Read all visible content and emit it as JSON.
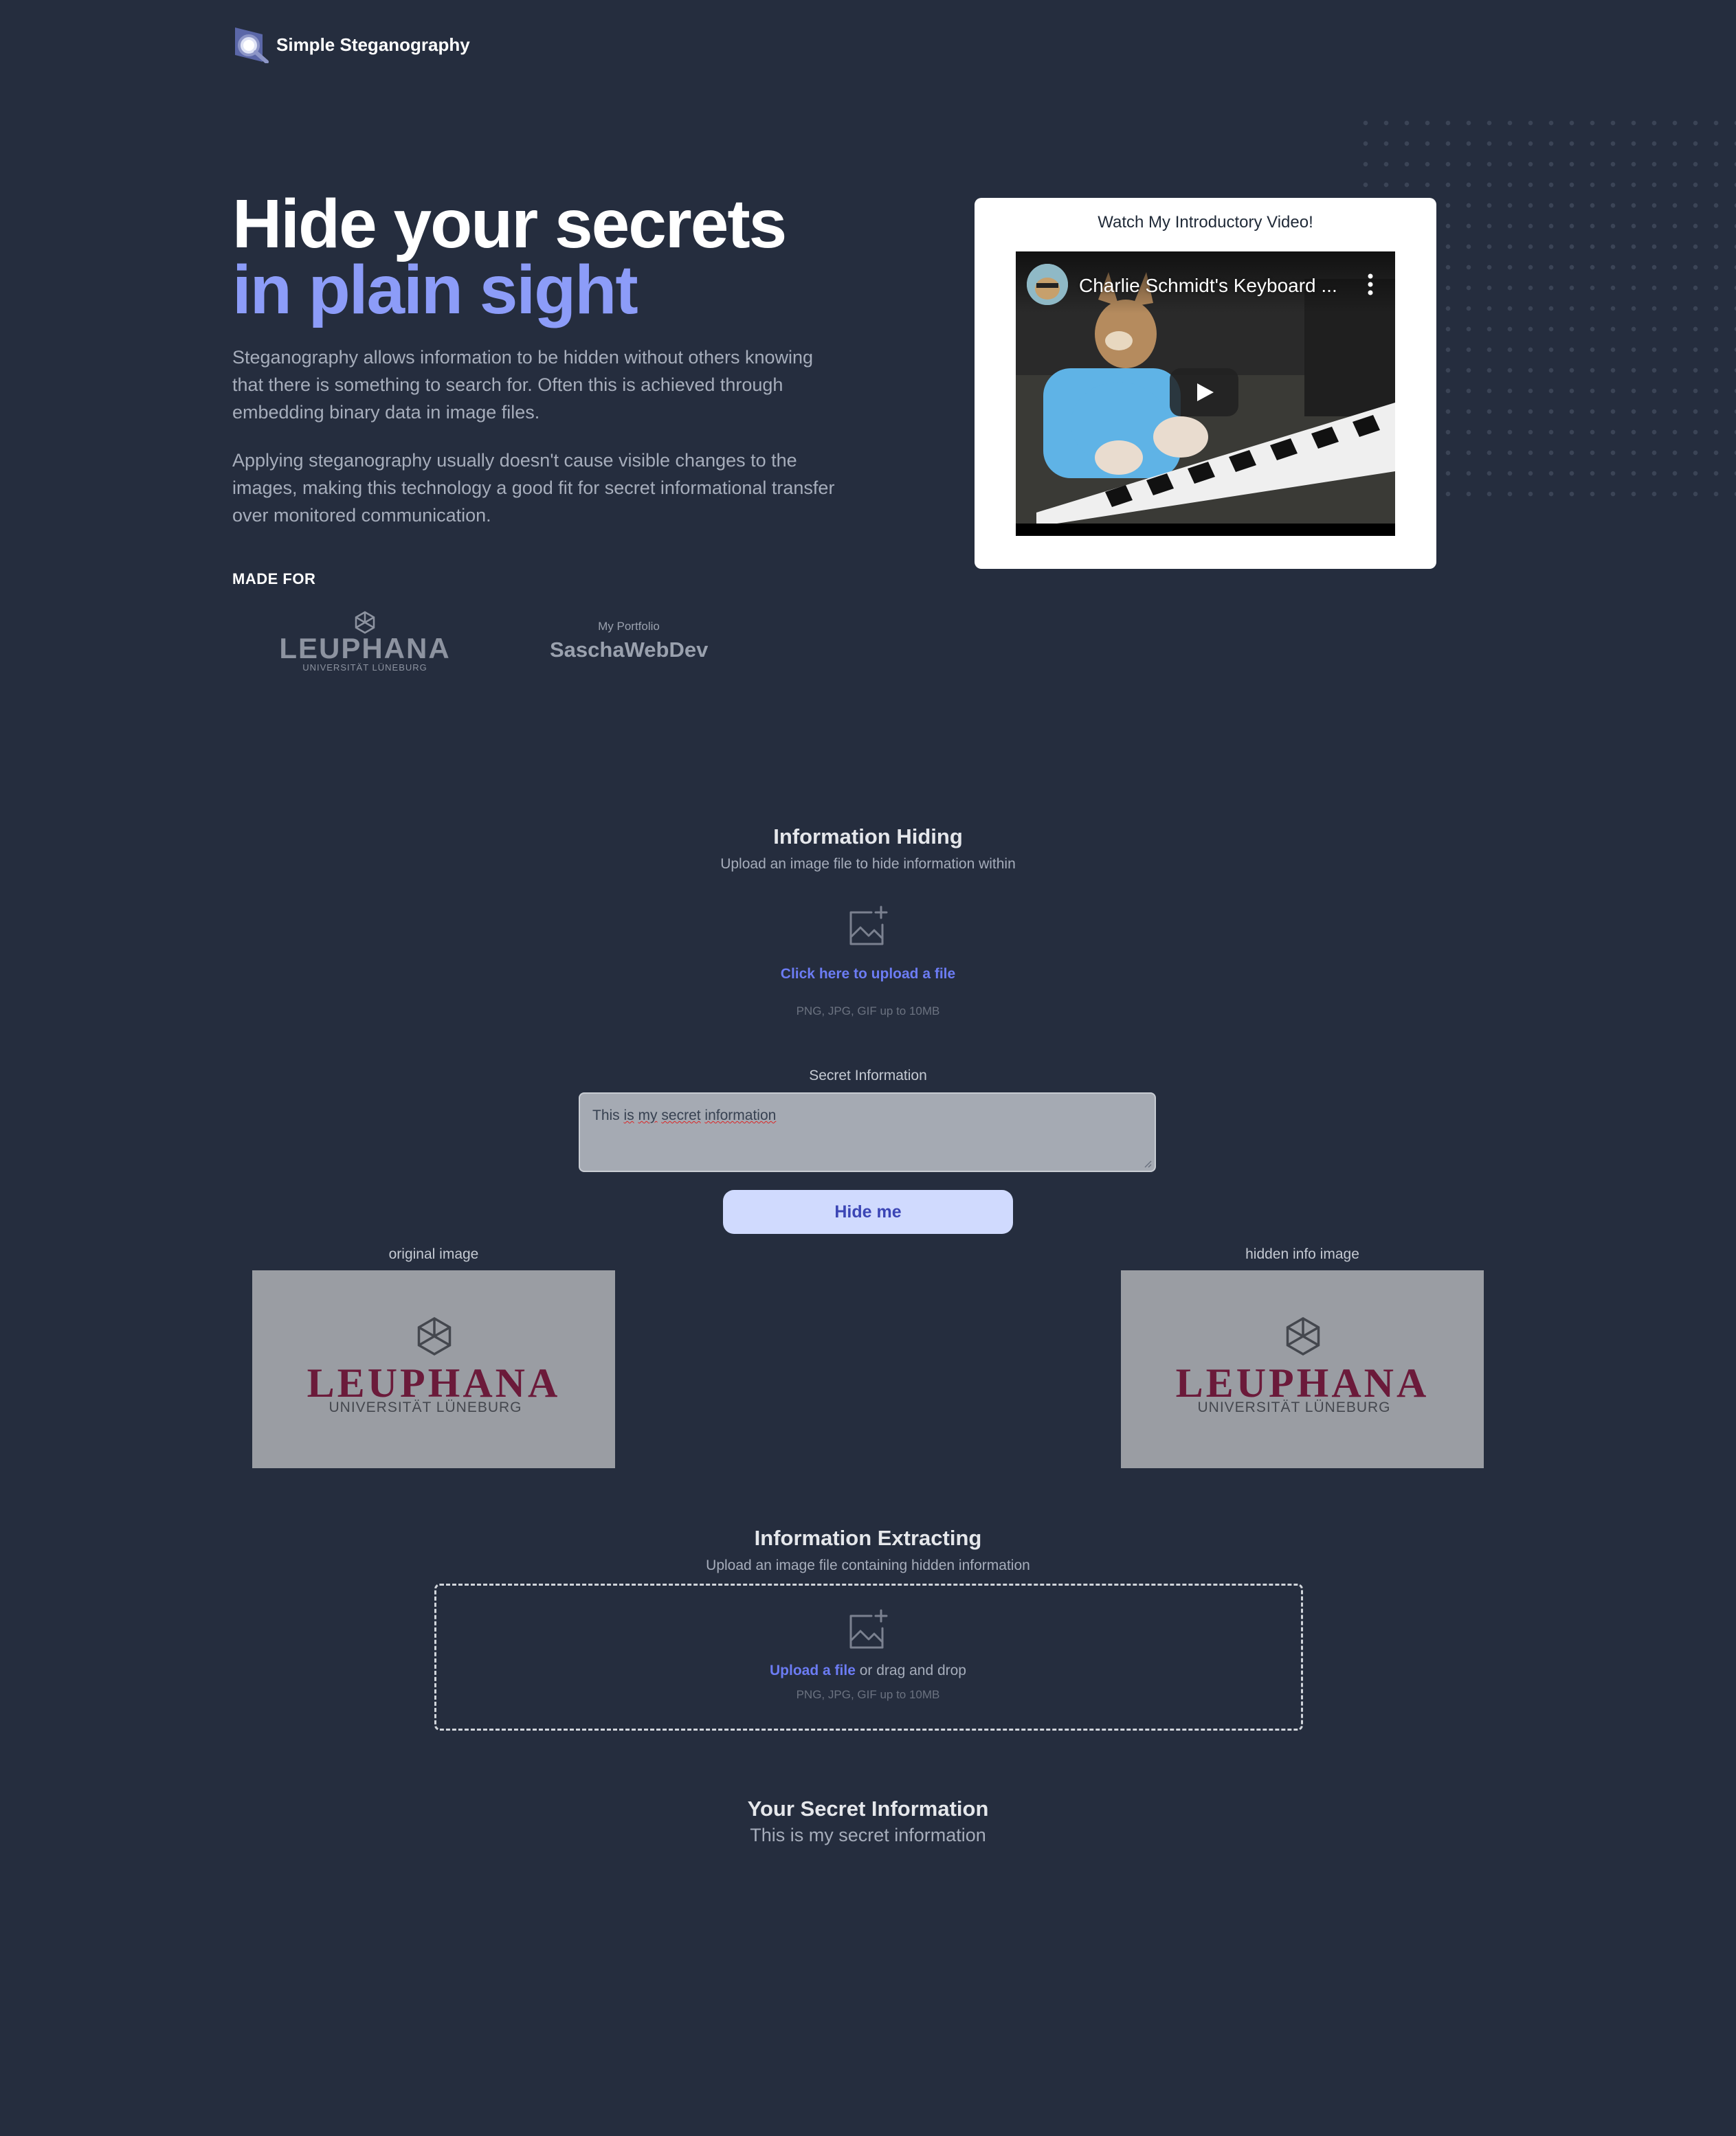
{
  "header": {
    "brand": "Simple Steganography"
  },
  "hero": {
    "title_line1": "Hide your secrets",
    "title_line2": "in plain sight",
    "paragraph1": "Steganography allows information to be hidden without others knowing that there is something to search for. Often this is achieved through embedding binary data in image files.",
    "paragraph2": "Applying steganography usually doesn't cause visible changes to the images, making this technology a good fit for secret informational transfer over monitored communication.",
    "made_for": "MADE FOR",
    "logo_leuphana_name": "LEUPHANA",
    "logo_leuphana_sub": "UNIVERSITÄT LÜNEBURG",
    "portfolio_small": "My Portfolio",
    "portfolio_big": "SaschaWebDev"
  },
  "video": {
    "card_title": "Watch My Introductory Video!",
    "video_title": "Charlie Schmidt's Keyboard ..."
  },
  "hiding": {
    "title": "Information Hiding",
    "subtitle": "Upload an image file to hide information within",
    "upload_link": "Click here to upload a file",
    "note": "PNG, JPG, GIF up to 10MB",
    "secret_label": "Secret Information",
    "secret_words": [
      "This",
      "is",
      "my",
      "secret",
      "information"
    ],
    "button": "Hide me",
    "original_label": "original image",
    "hidden_label": "hidden info image",
    "image_logo_name": "LEUPHANA",
    "image_logo_sub": "UNIVERSITÄT LÜNEBURG"
  },
  "extracting": {
    "title": "Information Extracting",
    "subtitle": "Upload an image file containing hidden information",
    "upload_link": "Upload a file",
    "upload_rest": " or drag and drop",
    "note": "PNG, JPG, GIF up to 10MB"
  },
  "result": {
    "title": "Your Secret Information",
    "text": "This is my secret information"
  },
  "colors": {
    "background": "#252d3e",
    "accent": "#8c9cf8",
    "link": "#6c7cf4",
    "button_bg": "#d0dafe",
    "leuphana_red": "#6b1a3a"
  }
}
